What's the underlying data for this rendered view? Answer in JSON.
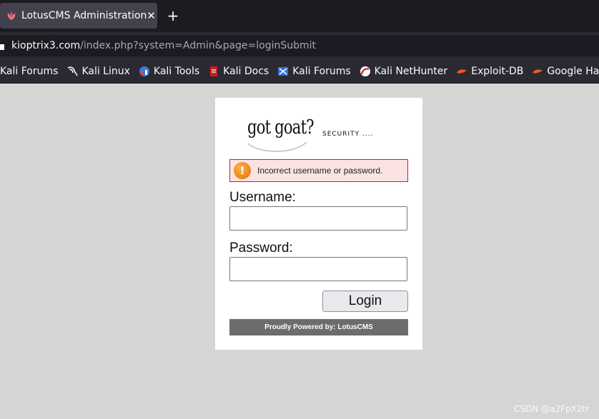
{
  "browser": {
    "tab": {
      "title": "LotusCMS Administration",
      "close": "✕",
      "favicon": "lotus-icon"
    },
    "new_tab": "+",
    "url": {
      "host": "kioptrix3.com",
      "path": "/index.php?system=Admin&page=loginSubmit"
    },
    "bookmarks": [
      {
        "label": "Kali Forums",
        "icon": "kali-icon"
      },
      {
        "label": "Kali Linux",
        "icon": "kali-dragon-icon"
      },
      {
        "label": "Kali Tools",
        "icon": "kali-tools-icon"
      },
      {
        "label": "Kali Docs",
        "icon": "kali-docs-icon"
      },
      {
        "label": "Kali Forums",
        "icon": "kali-forums-icon"
      },
      {
        "label": "Kali NetHunter",
        "icon": "nethunter-icon"
      },
      {
        "label": "Exploit-DB",
        "icon": "exploit-db-icon"
      },
      {
        "label": "Google Hacking",
        "icon": "google-hacking-icon"
      }
    ]
  },
  "page": {
    "logo": {
      "text": "got goat?",
      "subtitle": "SECURITY ...."
    },
    "error": {
      "message": "Incorrect username or password.",
      "icon": "warning-icon"
    },
    "form": {
      "username_label": "Username:",
      "username_value": "",
      "password_label": "Password:",
      "password_value": "",
      "submit_label": "Login"
    },
    "footer": "Proudly Powered by: LotusCMS"
  },
  "watermark": "CSDN @a2FpX2tr",
  "colors": {
    "tab_bg": "#42414d",
    "chrome_bg": "#2b2a33",
    "page_bg": "#d5d5d5",
    "error_border": "#c6202a",
    "footer_bg": "#6c6c6c"
  }
}
